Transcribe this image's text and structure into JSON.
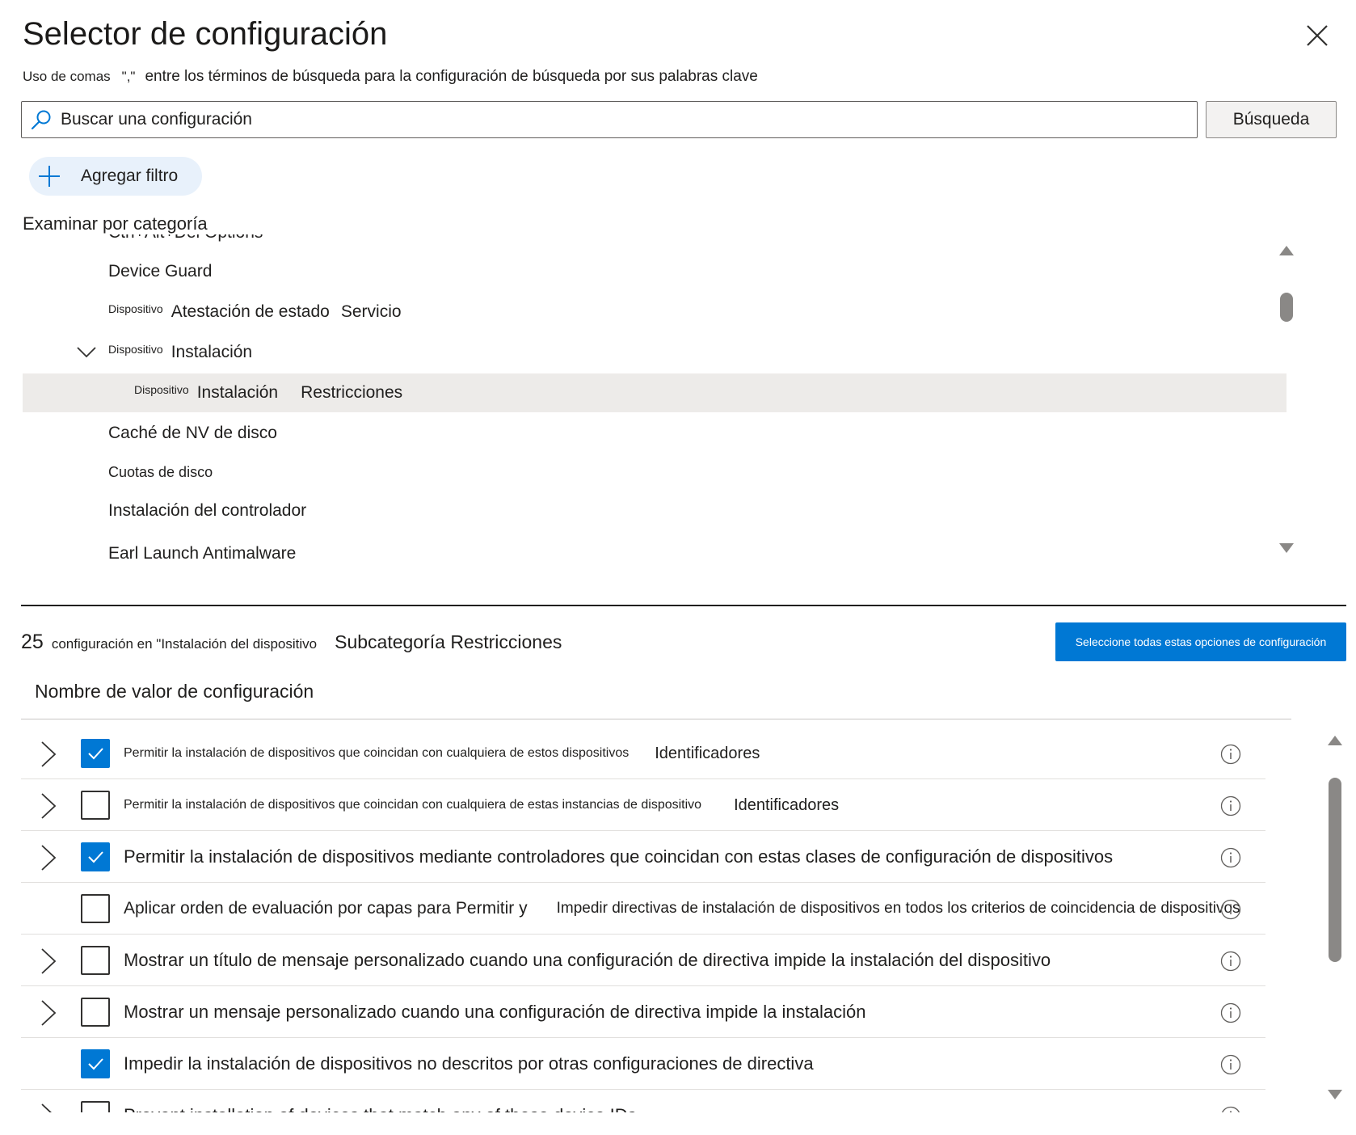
{
  "dialog": {
    "title": "Selector de configuración",
    "hint_before": "Uso de comas",
    "hint_quote": "\",\"",
    "hint_after": "entre los términos de búsqueda para la configuración de búsqueda por sus palabras clave"
  },
  "search": {
    "placeholder": "Buscar una configuración",
    "button_label": "Búsqueda"
  },
  "filter": {
    "add_label": "Agregar filtro"
  },
  "browse": {
    "label": "Examinar por categoría",
    "items": [
      {
        "text": "Ctrl+Alt+Del Options"
      },
      {
        "text": "Device Guard"
      },
      {
        "small": "Dispositivo",
        "text": "Atestación de estado",
        "text2": "Servicio"
      },
      {
        "small": "Dispositivo",
        "text": "Instalación"
      },
      {
        "small": "Dispositivo",
        "text": "Instalación",
        "text2": "Restricciones"
      },
      {
        "text": "Caché de NV de disco"
      },
      {
        "text": "Cuotas de disco"
      },
      {
        "text": "Instalación del controlador"
      },
      {
        "text": "Earl Launch Antimalware"
      }
    ]
  },
  "results": {
    "count": "25",
    "summary_small": "configuración en \"Instalación del dispositivo",
    "summary_big": "Subcategoría Restricciones",
    "select_all_label": "Seleccione todas estas opciones de configuración",
    "column_header": "Nombre de valor de configuración",
    "rows": [
      {
        "checked": true,
        "part1": "Permitir la instalación de dispositivos que coincidan con cualquiera de estos dispositivos",
        "part2": "Identificadores"
      },
      {
        "checked": false,
        "part1": "Permitir la instalación de dispositivos que coincidan con cualquiera de estas instancias de dispositivo",
        "part2": "Identificadores"
      },
      {
        "checked": true,
        "part1": "Permitir la instalación de dispositivos mediante controladores que coincidan con estas clases de configuración de dispositivos"
      },
      {
        "checked": false,
        "part1": "Aplicar orden de evaluación por capas para Permitir y",
        "part2": "Impedir directivas de instalación de dispositivos en todos los criterios de coincidencia de dispositivos"
      },
      {
        "checked": false,
        "part1": "Mostrar un título de mensaje personalizado cuando una configuración de directiva impide la instalación del dispositivo"
      },
      {
        "checked": false,
        "part1": "Mostrar un mensaje personalizado cuando una configuración de directiva impide la instalación"
      },
      {
        "checked": true,
        "part1": "Impedir la instalación de dispositivos no descritos por otras configuraciones de directiva"
      },
      {
        "checked": false,
        "part1": "Prevent installation of devices that match any of these device IDs"
      }
    ]
  },
  "colors": {
    "accent": "#0078d4",
    "selected_row": "#edebe9",
    "chip_bg": "#e8f1fb"
  }
}
